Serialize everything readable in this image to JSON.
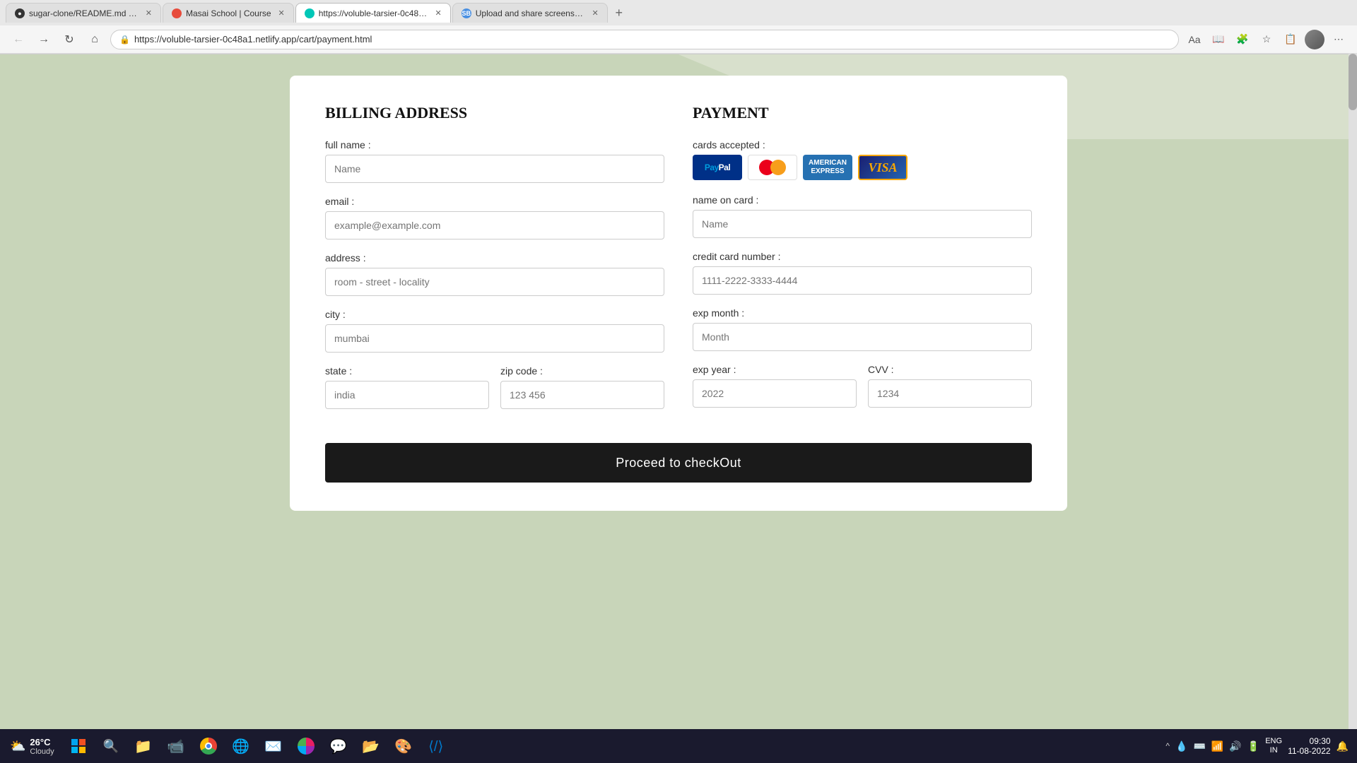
{
  "browser": {
    "tabs": [
      {
        "label": "sugar-clone/README.md at mai...",
        "favicon": "github",
        "active": false
      },
      {
        "label": "Masai School | Course",
        "favicon": "masai",
        "active": false
      },
      {
        "label": "https://voluble-tarsier-0c48a1.ne...",
        "favicon": "web",
        "active": true
      },
      {
        "label": "Upload and share screenshots a...",
        "favicon": "sb",
        "active": false
      }
    ],
    "url": "https://voluble-tarsier-0c48a1.netlify.app/cart/payment.html"
  },
  "billing": {
    "title": "BILLING ADDRESS",
    "fields": {
      "full_name_label": "full name :",
      "full_name_placeholder": "Name",
      "email_label": "email :",
      "email_placeholder": "example@example.com",
      "address_label": "address :",
      "address_placeholder": "room - street - locality",
      "city_label": "city :",
      "city_placeholder": "mumbai",
      "state_label": "state :",
      "state_placeholder": "india",
      "zip_label": "zip code :",
      "zip_placeholder": "123 456"
    }
  },
  "payment": {
    "title": "PAYMENT",
    "cards_label": "cards accepted :",
    "fields": {
      "name_on_card_label": "name on card :",
      "name_on_card_placeholder": "Name",
      "cc_number_label": "credit card number :",
      "cc_number_placeholder": "1111-2222-3333-4444",
      "exp_month_label": "exp month :",
      "exp_month_placeholder": "Month",
      "exp_year_label": "exp year :",
      "exp_year_placeholder": "2022",
      "cvv_label": "CVV :",
      "cvv_placeholder": "1234"
    }
  },
  "checkout_btn": "Proceed to checkOut",
  "taskbar": {
    "weather": "26°C",
    "weather_desc": "Cloudy",
    "time": "09:30",
    "date": "11-08-2022",
    "lang": "ENG\nIN"
  }
}
